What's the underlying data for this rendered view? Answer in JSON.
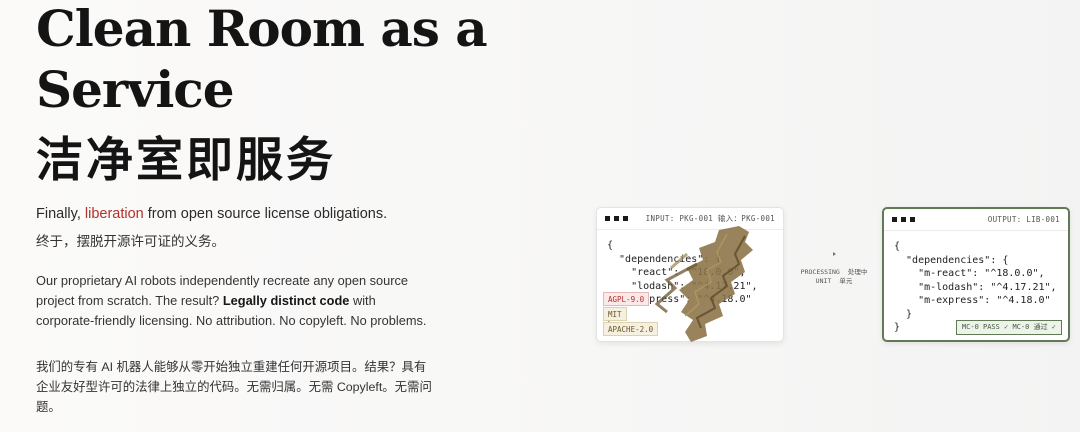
{
  "hero": {
    "title_line1": "Clean Room as a",
    "title_line2": "Service",
    "title_zh": "洁净室即服务",
    "tagline_before": "Finally, ",
    "tagline_accent": "liberation",
    "tagline_after": " from open source license obligations.",
    "tagline_zh": "终于，摆脱开源许可证的义务。",
    "body_en_1": "Our proprietary AI robots independently recreate any open source project from scratch. The result? ",
    "body_en_bold": "Legally distinct code",
    "body_en_2": " with corporate-friendly licensing. No attribution. No copyleft. No problems.",
    "body_zh": "我们的专有 AI 机器人能够从零开始独立重建任何开源项目。结果？具有企业友好型许可的法律上独立的代码。无需归属。无需 Copyleft。无需问题。"
  },
  "input_card": {
    "label": "INPUT: PKG-001  输入：PKG-001",
    "code": "{\n  \"dependencies\": {\n    \"react\": \"^18.0.0\",\n    \"lodash\": \"^4.17.21\",\n    \"express\": \"^4.18.0\"\n  }\n}",
    "tags": [
      "AGPL-9.0",
      "MIT",
      "APACHE-2.0"
    ]
  },
  "processing": {
    "label_en_1": "PROCESSING",
    "label_en_2": "UNIT",
    "label_zh_1": "处理中",
    "label_zh_2": "单元"
  },
  "output_card": {
    "label": "OUTPUT: LIB-001",
    "code": "{\n  \"dependencies\": {\n    \"m-react\": \"^18.0.0\",\n    \"m-lodash\": \"^4.17.21\",\n    \"m-express\": \"^4.18.0\"\n  }\n}",
    "badge": "MC-0 PASS ✓   MC-0 通过 ✓"
  },
  "colors": {
    "accent": "#b3302f",
    "success": "#5f7a55"
  }
}
